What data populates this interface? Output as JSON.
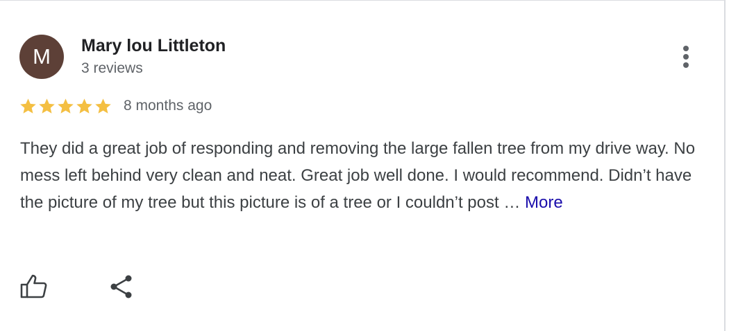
{
  "review": {
    "author": {
      "initial": "M",
      "name": "Mary lou Littleton",
      "review_count": "3 reviews",
      "avatar_color": "#5d4037"
    },
    "rating": 5,
    "rating_max": 5,
    "star_color": "#f4bf42",
    "date": "8 months ago",
    "text": "They did a great job of responding and removing the large fallen tree from my drive way. No mess left behind very clean and neat. Great job well done. I would recommend. Didn’t have the picture of my tree but this picture is of a tree or I couldn’t post …",
    "more_label": "More",
    "actions": {
      "like_icon": "thumbs-up-icon",
      "share_icon": "share-icon",
      "menu_icon": "more-vert-icon"
    }
  }
}
